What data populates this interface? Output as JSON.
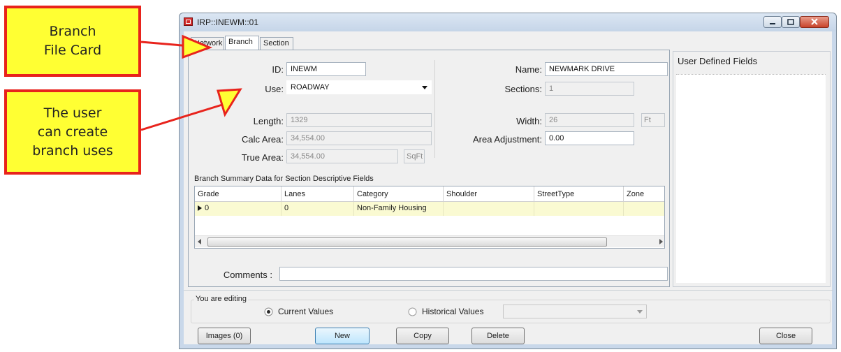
{
  "callouts": {
    "file_card": [
      "Branch",
      "File Card"
    ],
    "create_uses": [
      "The user",
      "can create",
      "branch uses"
    ]
  },
  "window": {
    "title": "IRP::INEWM::01"
  },
  "tabs": [
    {
      "label": "Network"
    },
    {
      "label": "Branch",
      "active": true
    },
    {
      "label": "Section"
    }
  ],
  "form": {
    "id_label": "ID:",
    "id_value": "INEWM",
    "use_label": "Use:",
    "use_value": "ROADWAY",
    "length_label": "Length:",
    "length_value": "1329",
    "calc_area_label": "Calc Area:",
    "calc_area_value": "34,554.00",
    "true_area_label": "True Area:",
    "true_area_value": "34,554.00",
    "true_area_unit": "SqFt",
    "name_label": "Name:",
    "name_value": "NEWMARK DRIVE",
    "sections_label": "Sections:",
    "sections_value": "1",
    "width_label": "Width:",
    "width_value": "26",
    "width_unit": "Ft",
    "area_adj_label": "Area Adjustment:",
    "area_adj_value": "0.00"
  },
  "summary": {
    "title": "Branch Summary Data for Section Descriptive Fields",
    "columns": [
      "Grade",
      "Lanes",
      "Category",
      "Shoulder",
      "StreetType",
      "Zone"
    ],
    "row": [
      "0",
      "0",
      "Non-Family Housing",
      "",
      "",
      ""
    ]
  },
  "comments_label": "Comments :",
  "user_defined_title": "User Defined Fields",
  "editing": {
    "title": "You are editing",
    "current": "Current Values",
    "historical": "Historical Values"
  },
  "buttons": {
    "images": "Images (0)",
    "new": "New",
    "copy": "Copy",
    "delete": "Delete",
    "close": "Close"
  },
  "colors": {
    "callout_fill": "#ffff33",
    "callout_border": "#e8231c",
    "arrow": "#e8231c",
    "selected_row": "#fafad2"
  }
}
